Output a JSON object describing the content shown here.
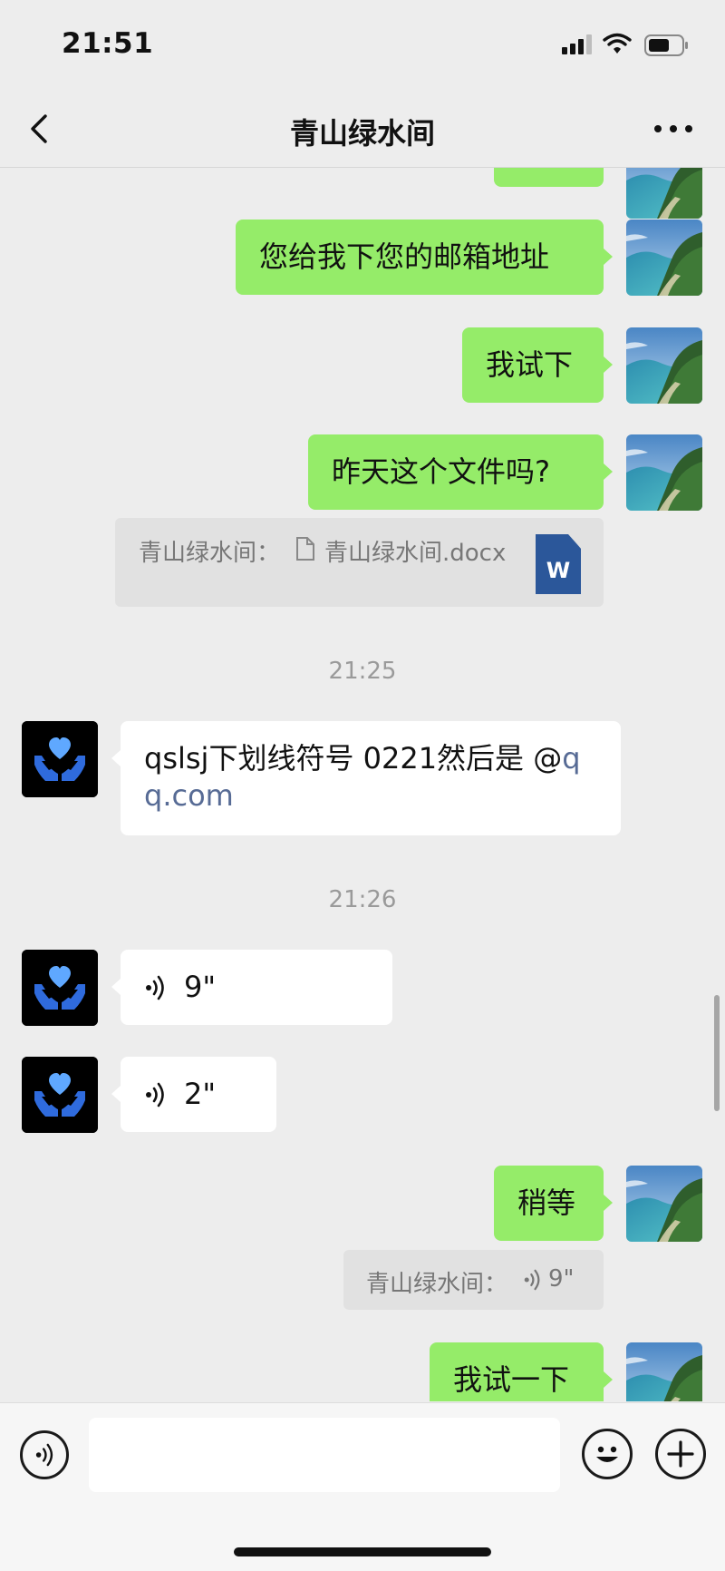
{
  "status": {
    "time": "21:51"
  },
  "header": {
    "title": "青山绿水间"
  },
  "messages": {
    "m0": "",
    "m1": "您给我下您的邮箱地址",
    "m2": "我试下",
    "m3": "昨天这个文件吗?",
    "quote1": {
      "prefix": "青山绿水间：",
      "filename": "青山绿水间.docx",
      "file_badge": "W"
    },
    "ts1": "21:25",
    "m4": {
      "text_line1": "qslsj下划线符号 0221然后是 @",
      "link_part1": "q",
      "link_part2": "q.com"
    },
    "ts2": "21:26",
    "v1": "9\"",
    "v2": "2\"",
    "m5": "稍等",
    "quote2": {
      "prefix": "青山绿水间：",
      "voice": "9\""
    },
    "m6": "我试一下"
  },
  "input": {
    "placeholder": ""
  },
  "icons": {
    "back": "chevron-left-icon",
    "more": "more-dots-icon",
    "voice_toggle": "voice-icon",
    "emoji": "emoji-icon",
    "plus": "plus-icon",
    "file": "doc-icon",
    "word": "word-file-icon"
  },
  "colors": {
    "bubble_me": "#95ec69",
    "bubble_them": "#ffffff",
    "bg": "#ededed",
    "link": "#576b95",
    "word_blue": "#2b579a"
  }
}
